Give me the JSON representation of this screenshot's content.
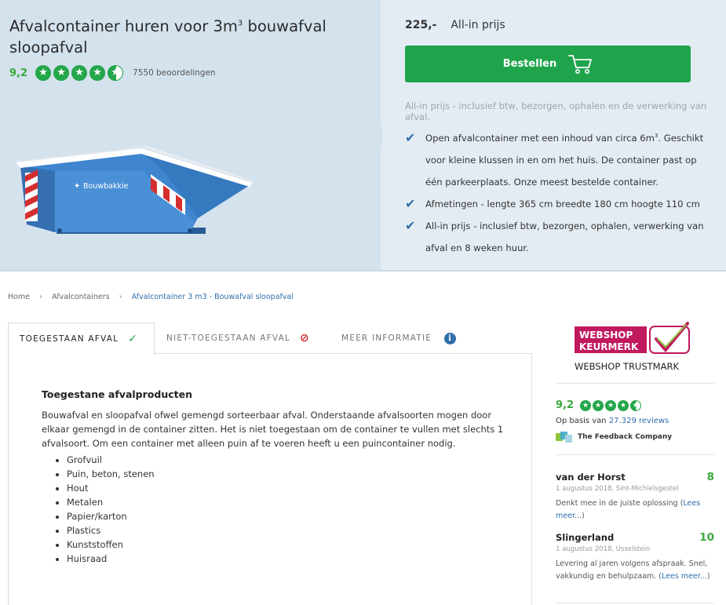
{
  "product": {
    "title_main": "Afvalcontainer huren voor 3m",
    "title_sup": "3",
    "title_rest": " bouwafval sloopafval",
    "rating": "9,2",
    "review_count": "7550 beoordelingen",
    "stars": 4.5,
    "container_brand": "Bouwbakkie"
  },
  "order": {
    "price": "225,-",
    "price_label": "All-in prijs",
    "button_label": "Bestellen",
    "price_note": "All-in prijs - inclusief btw, bezorgen, ophalen en de verwerking van afval."
  },
  "features": [
    {
      "pre": "Open afvalcontainer met een inhoud van circa 6m",
      "sup": "3",
      "post": ". Geschikt voor kleine klussen in en om het huis. De container past op één parkeerplaats. Onze meest bestelde container."
    },
    {
      "pre": "Afmetingen - lengte 365 cm breedte 180 cm hoogte 110 cm",
      "sup": "",
      "post": ""
    },
    {
      "pre": "All-in prijs - inclusief btw, bezorgen, ophalen, verwerking van afval en 8 weken huur.",
      "sup": "",
      "post": ""
    }
  ],
  "breadcrumb": {
    "home": "Home",
    "category": "Afvalcontainers",
    "current": "Afvalcontainer 3 m3 - Bouwafval sloopafval"
  },
  "tabs": {
    "allowed": "TOEGESTAAN AFVAL",
    "not_allowed": "NIET-TOEGESTAAN AFVAL",
    "more_info": "MEER INFORMATIE"
  },
  "panel": {
    "title": "Toegestane afvalproducten",
    "text": "Bouwafval en sloopafval ofwel gemengd sorteerbaar afval. Onderstaande afvalsoorten mogen door elkaar gemengd in de container zitten. Het is niet toegestaan om de container te vullen met slechts 1 afvalsoort. Om een container met alleen puin af te voeren heeft u een puincontainer nodig.",
    "items": [
      "Grofvuil",
      "Puin, beton, stenen",
      "Hout",
      "Metalen",
      "Papier/karton",
      "Plastics",
      "Kunststoffen",
      "Huisraad"
    ]
  },
  "sidebar": {
    "trust_logo": {
      "line1": "WEBSHOP",
      "line2": "KEURMERK",
      "line3": "WEBSHOP TRUSTMARK"
    },
    "rating": "9,2",
    "stars": 4.5,
    "based_on_prefix": "Op basis van ",
    "based_on_link": "27.329 reviews",
    "feedback_company": "The Feedback Company",
    "reviews": [
      {
        "name": "van der Horst",
        "score": "8",
        "meta": "1 augustus 2018, Sint-Michielsgestel",
        "text": "Denkt mee in de juiste oplossing (",
        "more": "Lees meer...",
        "close": ")"
      },
      {
        "name": "Slingerland",
        "score": "10",
        "meta": "1 augustus 2018, Usselstein",
        "text": "Levering al jaren volgens afspraak. Snel, vakkundig en behulpzaam. (",
        "more": "Lees meer...",
        "close": ")"
      }
    ]
  },
  "colors": {
    "green": "#1fa44c",
    "blue": "#2f6faa",
    "hero_bg": "#d4e2ee"
  }
}
